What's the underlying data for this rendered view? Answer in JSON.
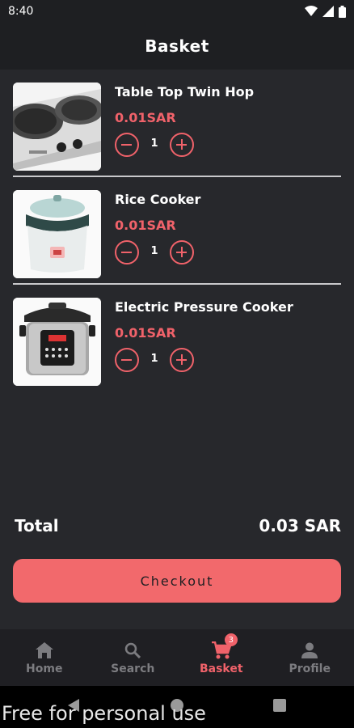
{
  "status_bar": {
    "time": "8:40"
  },
  "header": {
    "title": "Basket"
  },
  "items": [
    {
      "name": "Table Top Twin Hop",
      "price": "0.01SAR",
      "qty": "1",
      "image": "twin-hotplate"
    },
    {
      "name": "Rice Cooker",
      "price": "0.01SAR",
      "qty": "1",
      "image": "rice-cooker"
    },
    {
      "name": "Electric Pressure Cooker",
      "price": "0.01SAR",
      "qty": "1",
      "image": "pressure-cooker"
    }
  ],
  "total": {
    "label": "Total",
    "value": "0.03 SAR"
  },
  "checkout_label": "Checkout",
  "nav": {
    "home": "Home",
    "search": "Search",
    "basket": "Basket",
    "profile": "Profile",
    "basket_badge": "3",
    "active": "Basket"
  },
  "watermark": "Free for personal use",
  "colors": {
    "accent": "#f0626a",
    "background": "#27282c",
    "header": "#1e1f22"
  }
}
